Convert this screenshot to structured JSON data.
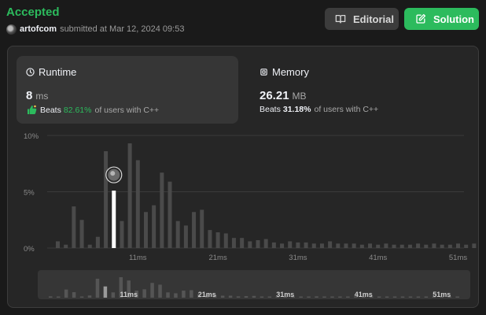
{
  "status": {
    "text": "Accepted",
    "color": "#2cbb5d"
  },
  "submission": {
    "username": "artofcom",
    "submitted_text": "submitted at Mar 12, 2024 09:53"
  },
  "buttons": {
    "editorial": {
      "label": "Editorial",
      "icon": "book-icon"
    },
    "solution": {
      "label": "Solution",
      "icon": "edit-icon",
      "color": "#2cbb5d"
    }
  },
  "runtime": {
    "label": "Runtime",
    "icon": "clock-icon",
    "value": "8",
    "unit": "ms",
    "beats_word": "Beats",
    "beats_pct": "82.61%",
    "beats_suffix": "of users with C++",
    "badge_icon": "thumbs-up-icon"
  },
  "memory": {
    "label": "Memory",
    "icon": "chip-icon",
    "value": "26.21",
    "unit": "MB",
    "beats_word": "Beats",
    "beats_pct": "31.18%",
    "beats_suffix": "of users with C++"
  },
  "chart_data": {
    "type": "bar",
    "ylabel": "",
    "xlabel": "",
    "y_ticks": [
      "10%",
      "5%",
      "0%"
    ],
    "ylim": [
      0,
      10
    ],
    "x_tick_labels": [
      "11ms",
      "21ms",
      "31ms",
      "41ms",
      "51ms"
    ],
    "categories": [
      1,
      2,
      3,
      4,
      5,
      6,
      7,
      8,
      9,
      10,
      11,
      12,
      13,
      14,
      15,
      16,
      17,
      18,
      19,
      20,
      21,
      22,
      23,
      24,
      25,
      26,
      27,
      28,
      29,
      30,
      31,
      32,
      33,
      34,
      35,
      36,
      37,
      38,
      39,
      40,
      41,
      42,
      43,
      44,
      45,
      46,
      47,
      48,
      49,
      50,
      51,
      52,
      53
    ],
    "values": [
      0.6,
      0.3,
      3.7,
      2.5,
      0.3,
      1.0,
      8.6,
      5.1,
      2.4,
      9.3,
      7.8,
      3.2,
      3.8,
      6.7,
      5.9,
      2.4,
      2.0,
      3.2,
      3.4,
      1.6,
      1.4,
      1.3,
      0.9,
      0.9,
      0.6,
      0.7,
      0.8,
      0.5,
      0.4,
      0.6,
      0.5,
      0.5,
      0.4,
      0.4,
      0.6,
      0.4,
      0.4,
      0.4,
      0.3,
      0.4,
      0.3,
      0.4,
      0.3,
      0.3,
      0.3,
      0.4,
      0.3,
      0.4,
      0.3,
      0.3,
      0.4,
      0.3,
      0.4
    ],
    "highlight_index": 7,
    "grid": true,
    "colors": {
      "bar": "#4a4a4a",
      "highlight": "#ffffff",
      "grid": "#3a3a3a"
    }
  }
}
